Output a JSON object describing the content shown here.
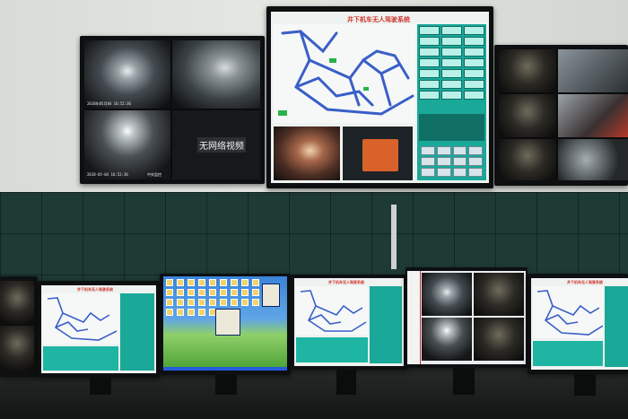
{
  "scene": {
    "accent_colors": {
      "system_title_red": "#d1342b",
      "panel_teal": "#1aa898",
      "wall_tile_green": "#1e3a34",
      "xp_sky_blue": "#3b84d9"
    }
  },
  "top_left_monitor": {
    "overlay_text": "无网络视频",
    "cam_timestamps": [
      "2018年05月04 16:52:36",
      "2018-05-04 16:52:36"
    ],
    "cam_label": "中央监控"
  },
  "top_center_monitor": {
    "system_title": "井下机车无人驾驶系统"
  },
  "bottom_row": {
    "monitor_2_title": "井下机车无人驾驶系统",
    "monitor_4_title": "井下机车无人驾驶系统",
    "monitor_6_title": "井下机车无人驾驶系统"
  }
}
